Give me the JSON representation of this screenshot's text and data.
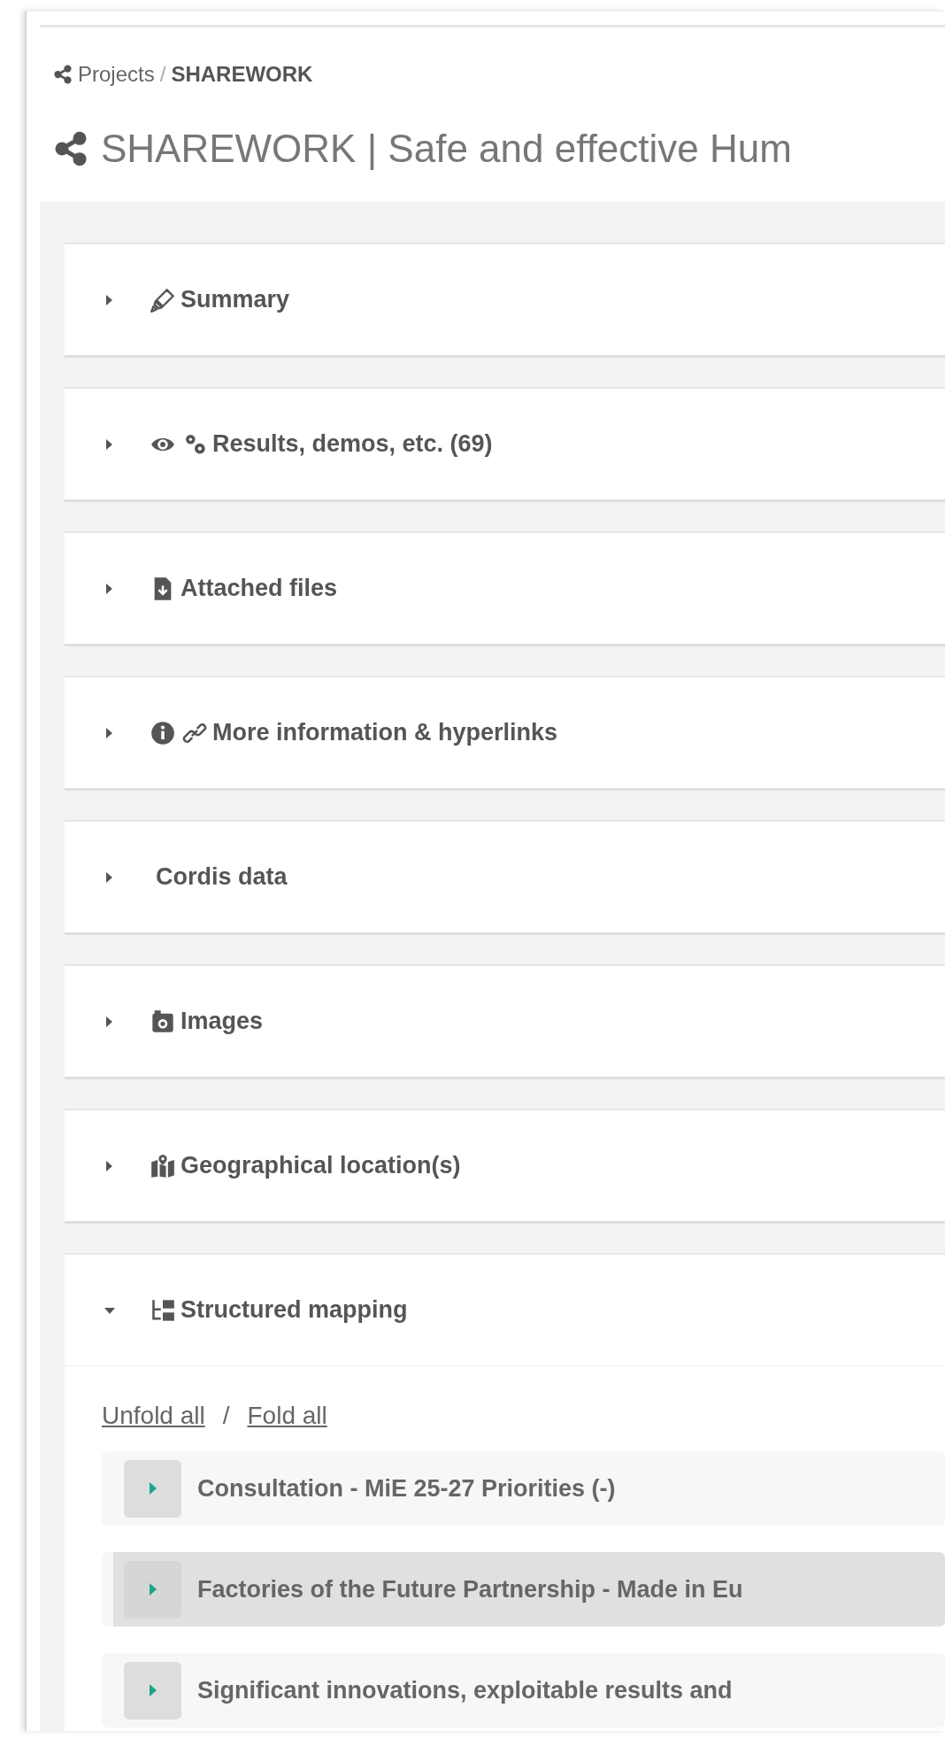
{
  "breadcrumb": {
    "parent": "Projects",
    "separator": "/",
    "current": "SHAREWORK"
  },
  "title": "SHAREWORK | Safe and effective Hum",
  "sections": [
    {
      "title": "Summary",
      "expanded": false
    },
    {
      "title": "Results, demos, etc. (69)",
      "expanded": false
    },
    {
      "title": "Attached files",
      "expanded": false
    },
    {
      "title": "More information & hyperlinks",
      "expanded": false
    },
    {
      "title": "Cordis data",
      "expanded": false
    },
    {
      "title": "Images",
      "expanded": false
    },
    {
      "title": "Geographical location(s)",
      "expanded": false
    },
    {
      "title": "Structured mapping",
      "expanded": true
    }
  ],
  "mapping": {
    "unfold": "Unfold all",
    "separator": "/",
    "fold": "Fold all",
    "items": [
      {
        "label": "Consultation - MiE 25-27 Priorities (-)",
        "selected": false
      },
      {
        "label": "Factories of the Future Partnership - Made in Eu",
        "selected": true
      },
      {
        "label": "Significant innovations, exploitable results and",
        "selected": false
      }
    ]
  }
}
